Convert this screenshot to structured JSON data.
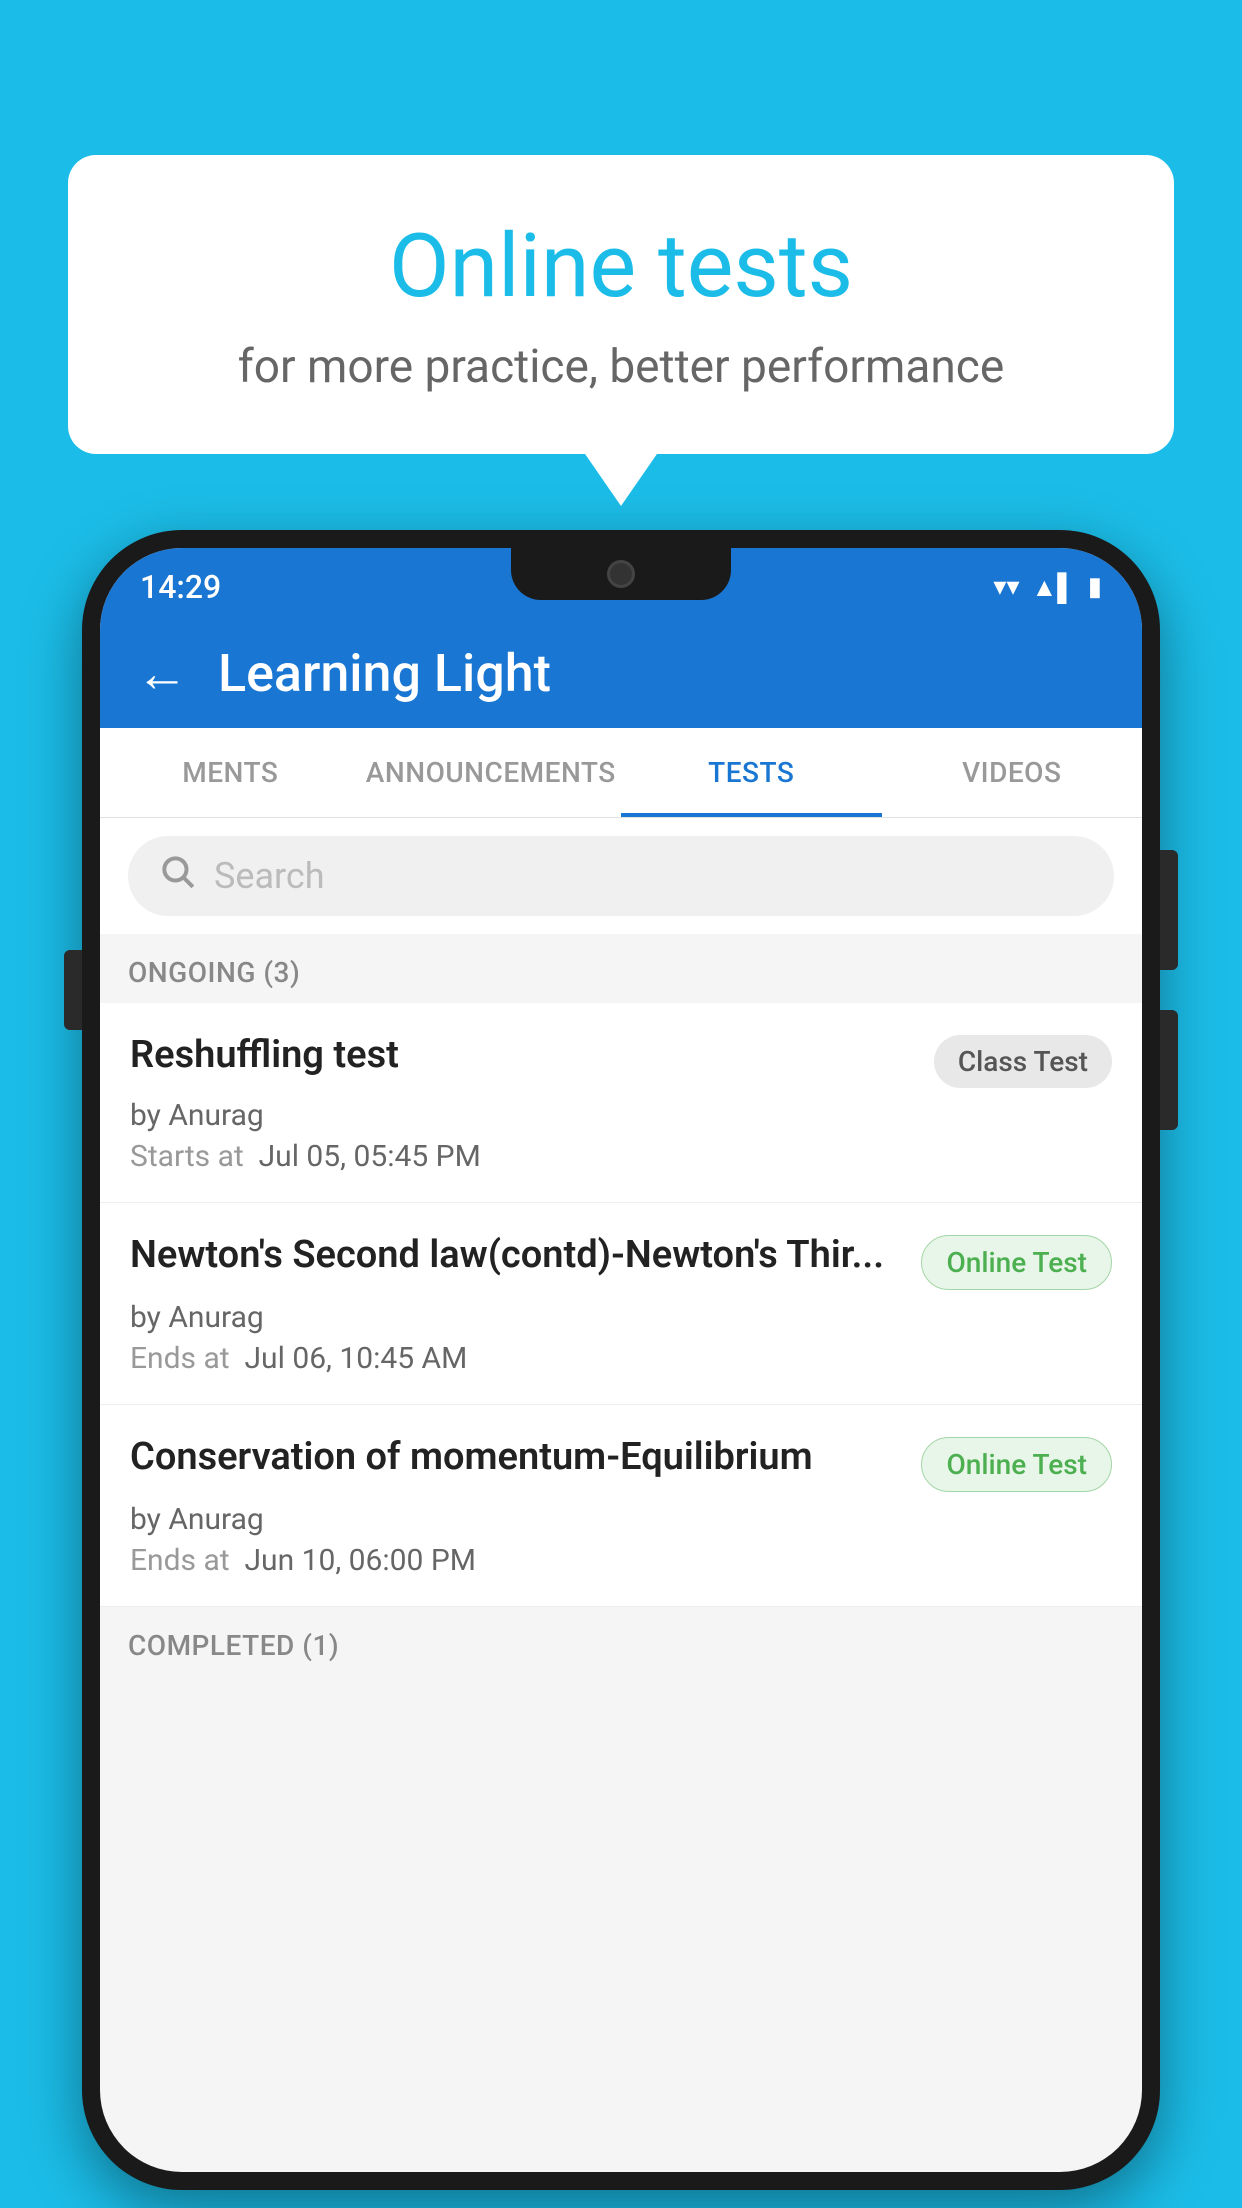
{
  "background_color": "#1BBDE8",
  "bubble": {
    "title": "Online tests",
    "subtitle": "for more practice, better performance"
  },
  "status_bar": {
    "time": "14:29",
    "wifi_icon": "▼",
    "signal_icon": "◀",
    "battery_icon": "▮"
  },
  "app_bar": {
    "title": "Learning Light",
    "back_label": "←"
  },
  "tabs": [
    {
      "label": "MENTS",
      "active": false
    },
    {
      "label": "ANNOUNCEMENTS",
      "active": false
    },
    {
      "label": "TESTS",
      "active": true
    },
    {
      "label": "VIDEOS",
      "active": false
    }
  ],
  "search": {
    "placeholder": "Search"
  },
  "ongoing_section": {
    "label": "ONGOING (3)"
  },
  "tests": [
    {
      "title": "Reshuffling test",
      "badge": "Class Test",
      "badge_type": "class",
      "author": "by Anurag",
      "time_label": "Starts at",
      "time_value": "Jul 05, 05:45 PM"
    },
    {
      "title": "Newton's Second law(contd)-Newton's Thir...",
      "badge": "Online Test",
      "badge_type": "online",
      "author": "by Anurag",
      "time_label": "Ends at",
      "time_value": "Jul 06, 10:45 AM"
    },
    {
      "title": "Conservation of momentum-Equilibrium",
      "badge": "Online Test",
      "badge_type": "online",
      "author": "by Anurag",
      "time_label": "Ends at",
      "time_value": "Jun 10, 06:00 PM"
    }
  ],
  "completed_section": {
    "label": "COMPLETED (1)"
  }
}
